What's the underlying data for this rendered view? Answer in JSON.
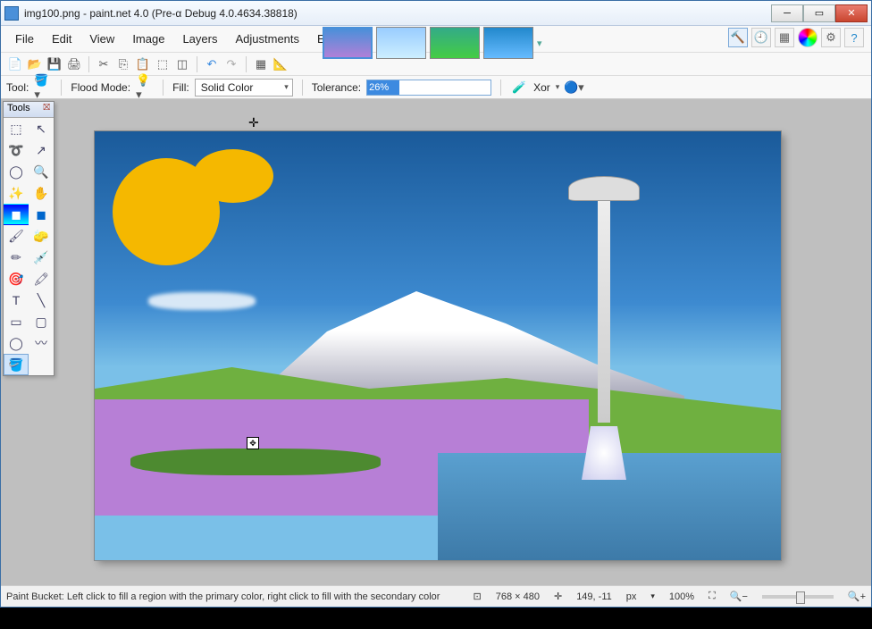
{
  "title": "img100.png - paint.net 4.0 (Pre-α Debug 4.0.4634.38818)",
  "menu": [
    "File",
    "Edit",
    "View",
    "Image",
    "Layers",
    "Adjustments",
    "Effects"
  ],
  "toolbar2": {
    "tool_label": "Tool:",
    "flood_label": "Flood Mode:",
    "fill_label": "Fill:",
    "fill_value": "Solid Color",
    "tolerance_label": "Tolerance:",
    "tolerance_value": "26%",
    "xor_label": "Xor"
  },
  "tools_panel": {
    "title": "Tools"
  },
  "status": {
    "hint": "Paint Bucket: Left click to fill a region with the primary color, right click to fill with the secondary color",
    "size": "768 × 480",
    "coords": "149, -11",
    "unit": "px",
    "zoom": "100%"
  }
}
